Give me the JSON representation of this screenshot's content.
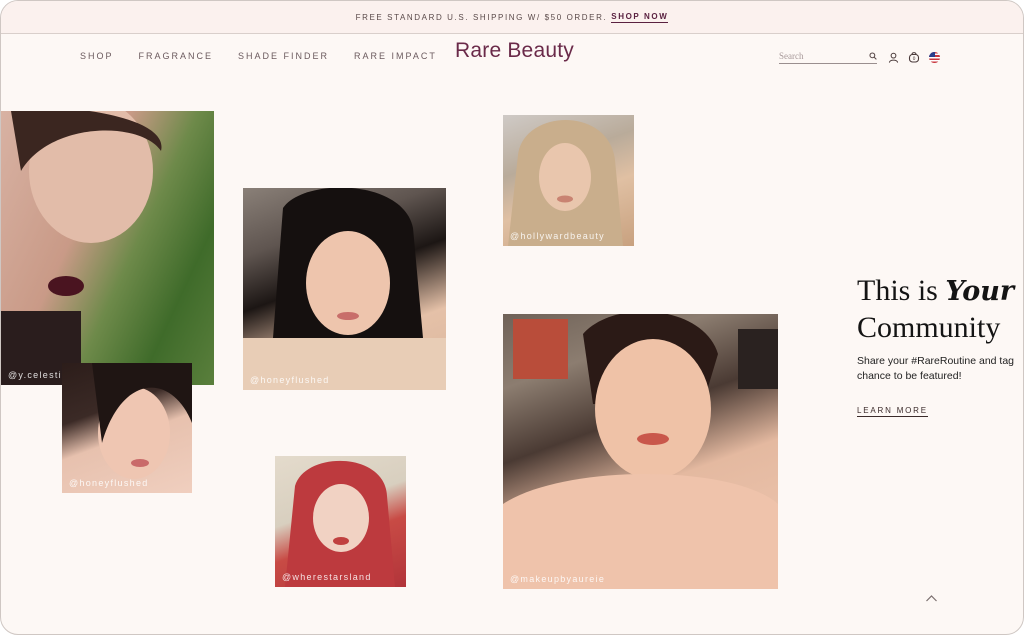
{
  "announcement": {
    "text": "FREE STANDARD U.S. SHIPPING W/ $50 ORDER.",
    "link": "SHOP NOW"
  },
  "nav": {
    "items": [
      "SHOP",
      "FRAGRANCE",
      "SHADE FINDER",
      "RARE IMPACT"
    ]
  },
  "brand": {
    "logo": "Rare Beauty",
    "accent": "#6a2a49"
  },
  "search": {
    "placeholder": "Search"
  },
  "icons": {
    "search": "search-icon",
    "account": "user-icon",
    "bag": "bag-icon",
    "region": "us-flag-icon",
    "back_to_top": "chevron-up-icon"
  },
  "photos": [
    {
      "handle": "@y.celestial"
    },
    {
      "handle": "@honeyflushed"
    },
    {
      "handle": "@honeyflushed"
    },
    {
      "handle": "@wherestarsland"
    },
    {
      "handle": "@hollywardbeauty"
    },
    {
      "handle": "@makeupbyaureie"
    }
  ],
  "hero": {
    "title_line1": "This is",
    "title_script": "Your",
    "title_line2": "Community",
    "body": "Share your #RareRoutine and tag chance to be featured!",
    "cta": "LEARN MORE"
  }
}
